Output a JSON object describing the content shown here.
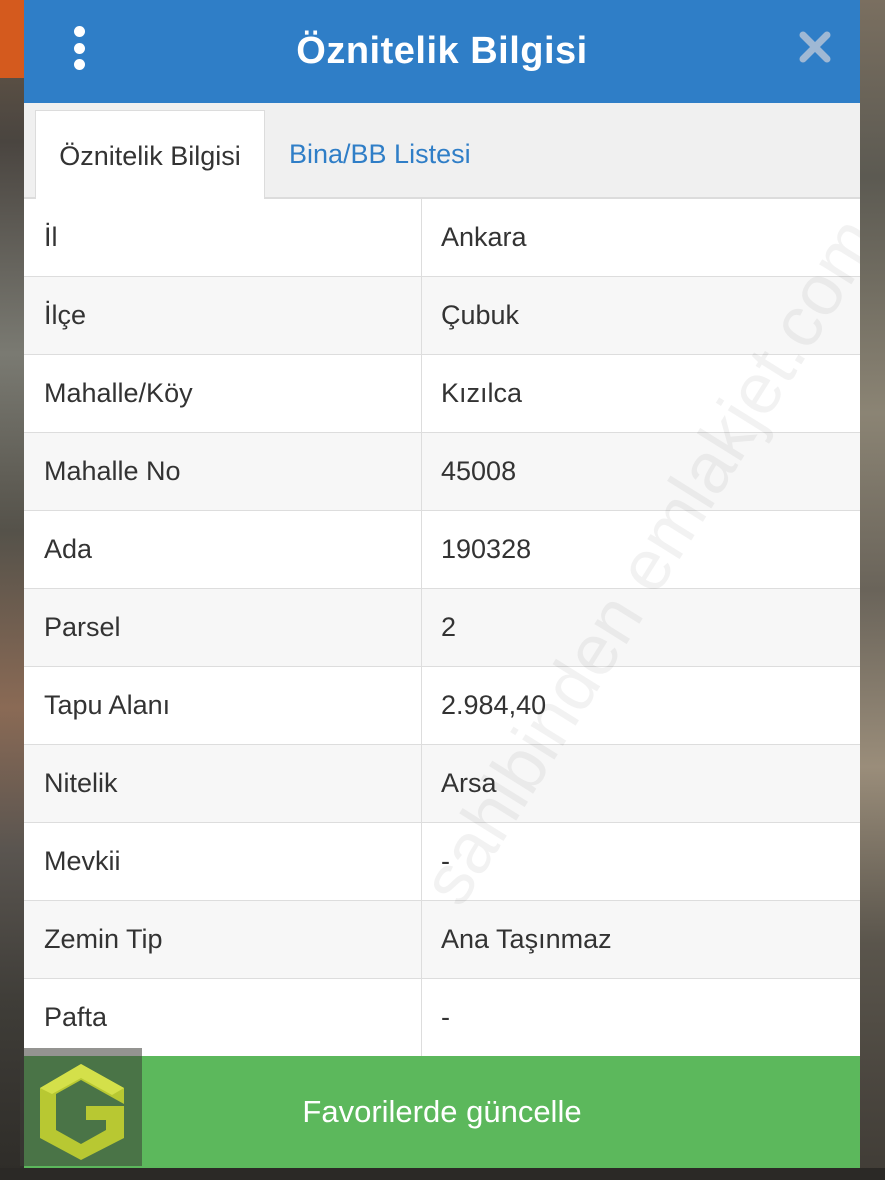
{
  "header": {
    "title": "Öznitelik Bilgisi",
    "menu_icon": "kebab-menu-icon",
    "close_icon": "close-icon"
  },
  "tabs": [
    {
      "label": "Öznitelik Bilgisi",
      "active": true
    },
    {
      "label": "Bina/BB Listesi",
      "active": false
    }
  ],
  "rows": [
    {
      "label": "İl",
      "value": "Ankara"
    },
    {
      "label": "İlçe",
      "value": "Çubuk"
    },
    {
      "label": "Mahalle/Köy",
      "value": "Kızılca"
    },
    {
      "label": "Mahalle No",
      "value": "45008"
    },
    {
      "label": "Ada",
      "value": "190328"
    },
    {
      "label": "Parsel",
      "value": "2"
    },
    {
      "label": "Tapu Alanı",
      "value": "2.984,40"
    },
    {
      "label": "Nitelik",
      "value": "Arsa"
    },
    {
      "label": "Mevkii",
      "value": "-"
    },
    {
      "label": "Zemin Tip",
      "value": "Ana Taşınmaz"
    },
    {
      "label": "Pafta",
      "value": "-"
    }
  ],
  "footer": {
    "favorites_button": "Favorilerde güncelle"
  },
  "watermark": "sahibinden emlakjet.com",
  "colors": {
    "header": "#2f7ec7",
    "tab_link": "#2f7ec7",
    "button": "#5cb85c",
    "logo": "#b8c832"
  }
}
